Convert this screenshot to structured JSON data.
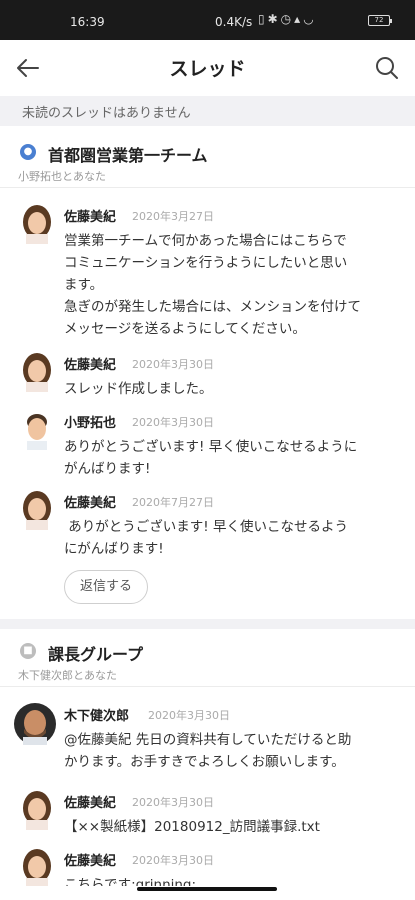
{
  "status_bar": {
    "time": "16:39",
    "net_speed": "0.4K/s",
    "icons": [
      "no-sim-icon",
      "bluetooth-icon",
      "alarm-icon",
      "signal-icon",
      "wifi-icon",
      "battery-icon"
    ],
    "battery": "72"
  },
  "app_bar": {
    "title": "スレッド",
    "back_icon": "arrow-left-icon",
    "search_icon": "search-icon"
  },
  "unread_notice": "未読のスレッドはありません",
  "threads": [
    {
      "group_name": "首都圏営業第一チーム",
      "members": "小野拓也とあなた",
      "messages": [
        {
          "sender": "佐藤美紀",
          "date": "2020年3月27日",
          "text": "営業第一チームで何かあった場合にはこちらで\nコミュニケーションを行うようにしたいと思い\nます。\n急ぎのが発生した場合には、メンションを付けて\nメッセージを送るようにしてください。"
        },
        {
          "sender": "佐藤美紀",
          "date": "2020年3月30日",
          "text": "スレッド作成しました。"
        },
        {
          "sender": "小野拓也",
          "date": "2020年3月30日",
          "text": "ありがとうございます! 早く使いこなせるように\nがんばります!"
        },
        {
          "sender": "佐藤美紀",
          "date": "2020年7月27日",
          "text": " ありがとうございます! 早く使いこなせるよう\nにがんばります!"
        }
      ],
      "reply_label": "返信する"
    },
    {
      "group_name": "課長グループ",
      "members": "木下健次郎とあなた",
      "messages": [
        {
          "sender": "木下健次郎",
          "date": "2020年3月30日",
          "text": "@佐藤美紀 先日の資料共有していただけると助\nかります。お手すきでよろしくお願いします。"
        },
        {
          "sender": "佐藤美紀",
          "date": "2020年3月30日",
          "text": "【××製紙様】20180912_訪問議事録.txt"
        },
        {
          "sender": "佐藤美紀",
          "date": "2020年3月30日",
          "text": "こちらです:grinning:"
        }
      ]
    }
  ],
  "colors": {
    "status_bar_bg": "#1a1a1a",
    "group_icon": "#4a7fd1",
    "lock_icon": "#bdbdbd",
    "separator_bg": "#f1f1f4"
  }
}
